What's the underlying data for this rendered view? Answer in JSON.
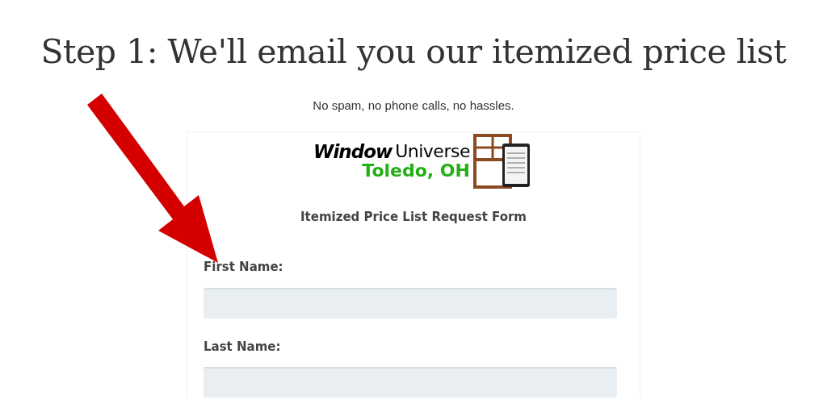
{
  "heading": "Step 1: We'll email you our itemized price list",
  "subheading": "No spam, no phone calls, no hassles.",
  "logo": {
    "name_bold": "Window",
    "name_light": "Universe",
    "location": "Toledo, OH"
  },
  "form": {
    "title": "Itemized Price List Request Form",
    "fields": [
      {
        "label": "First Name:"
      },
      {
        "label": "Last Name:"
      }
    ]
  }
}
